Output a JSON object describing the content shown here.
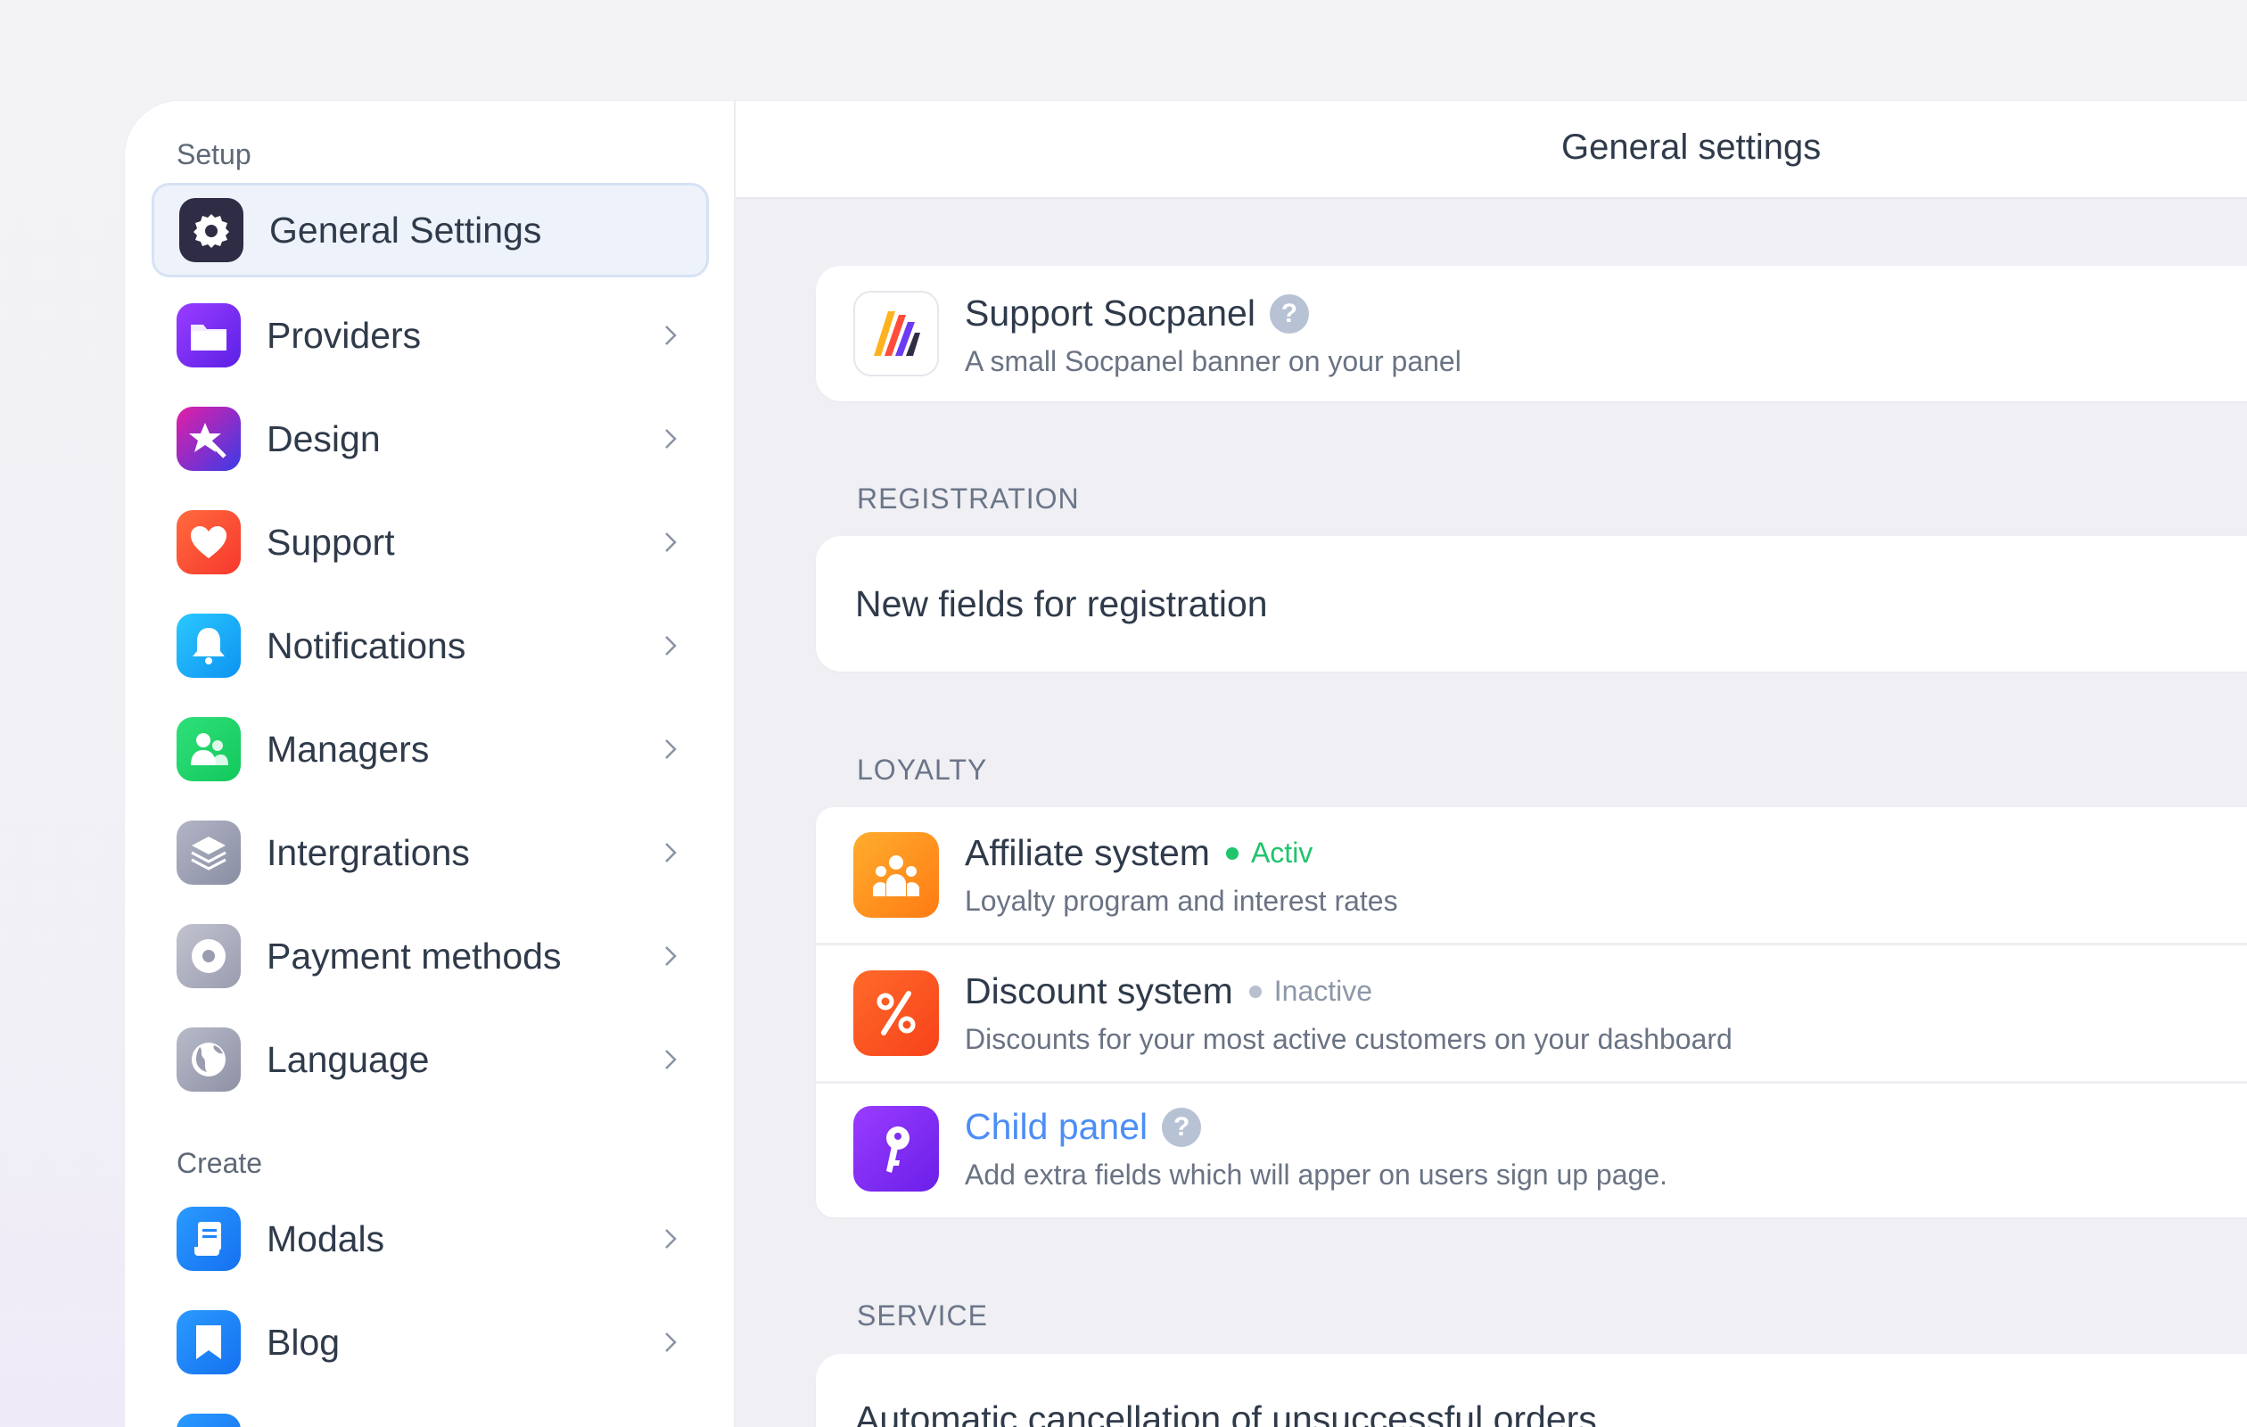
{
  "sidebar": {
    "sections": {
      "setup": "Setup",
      "create": "Create"
    },
    "items": [
      {
        "label": "General Settings",
        "icon": "gear-icon",
        "color": "#2f2d45",
        "active": true
      },
      {
        "label": "Providers",
        "icon": "folder-icon",
        "color": "#7b2ff2"
      },
      {
        "label": "Design",
        "icon": "magic-wand-icon",
        "color": "#7a2fd8"
      },
      {
        "label": "Support",
        "icon": "heart-icon",
        "color": "#ff5a36"
      },
      {
        "label": "Notifications",
        "icon": "bell-icon",
        "color": "#1ab3f5"
      },
      {
        "label": "Managers",
        "icon": "users-icon",
        "color": "#22d46b"
      },
      {
        "label": "Intergrations",
        "icon": "layers-icon",
        "color": "#9ba0b3"
      },
      {
        "label": "Payment methods",
        "icon": "coin-icon",
        "color": "#a6a9b8"
      },
      {
        "label": "Language",
        "icon": "globe-icon",
        "color": "#9ca0b0"
      }
    ],
    "create_items": [
      {
        "label": "Modals",
        "icon": "scroll-icon",
        "color": "#1f86ff"
      },
      {
        "label": "Blog",
        "icon": "bookmark-icon",
        "color": "#1f86ff"
      }
    ]
  },
  "header": {
    "title": "General settings"
  },
  "main": {
    "support": {
      "title": "Support Socpanel",
      "subtitle": "A small Socpanel banner on your panel",
      "help": "?"
    },
    "registration": {
      "heading": "REGISTRATION",
      "row_title": "New fields for registration"
    },
    "loyalty": {
      "heading": "LOYALTY",
      "rows": [
        {
          "title": "Affiliate system",
          "status": "Activ",
          "status_color": "#1fc46b",
          "subtitle": "Loyalty program and interest rates"
        },
        {
          "title": "Discount system",
          "status": "Inactive",
          "status_color": "#8d97a8",
          "subtitle": "Discounts for your most active customers on your dashboard"
        },
        {
          "title": "Child panel",
          "help": "?",
          "title_color": "#4d8ef5",
          "subtitle": "Add extra fields which will apper on users sign up page."
        }
      ]
    },
    "service": {
      "heading": "SERVICE",
      "row_title": "Automatic cancellation of unsuccessful orders"
    }
  }
}
